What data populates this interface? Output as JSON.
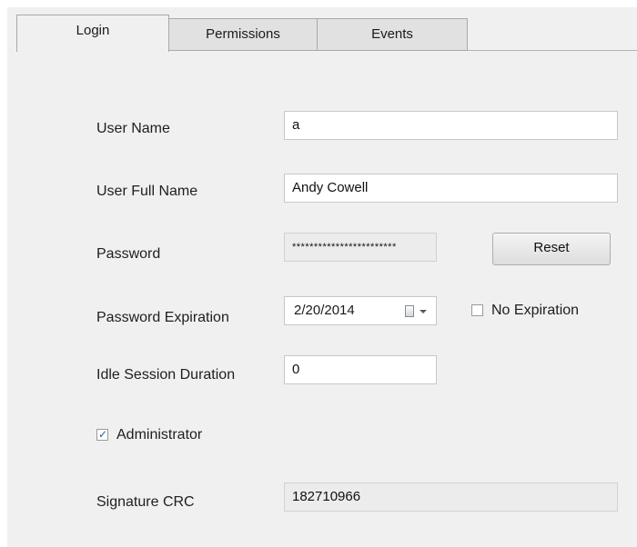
{
  "tabs": [
    {
      "label": "Login",
      "active": true
    },
    {
      "label": "Permissions",
      "active": false
    },
    {
      "label": "Events",
      "active": false
    }
  ],
  "form": {
    "user_name": {
      "label": "User Name",
      "value": "a"
    },
    "user_full_name": {
      "label": "User Full Name",
      "value": "Andy Cowell"
    },
    "password": {
      "label": "Password",
      "value": "************************",
      "reset_label": "Reset"
    },
    "password_expiration": {
      "label": "Password Expiration",
      "value": "2/20/2014",
      "no_expiration_label": "No Expiration",
      "no_expiration_checked": false
    },
    "idle_session_duration": {
      "label": "Idle Session Duration",
      "value": "0"
    },
    "administrator": {
      "label": "Administrator",
      "checked": true
    },
    "signature_crc": {
      "label": "Signature CRC",
      "value": "182710966"
    }
  },
  "icons": {
    "calendar": "calendar-icon",
    "dropdown": "chevron-down-icon",
    "checkmark": "checkmark-icon"
  },
  "colors": {
    "panel": "#f0f0f0",
    "checkmark": "#2a5aa8"
  }
}
